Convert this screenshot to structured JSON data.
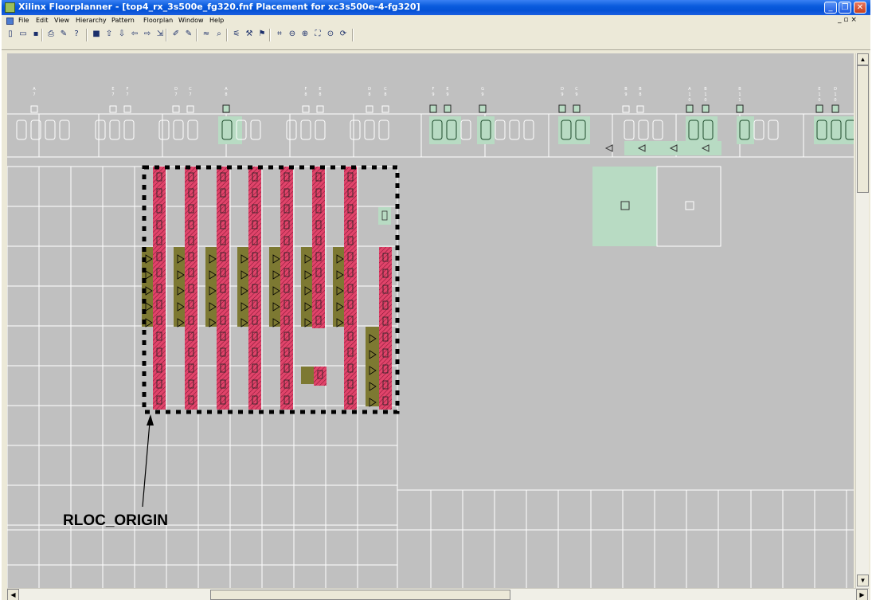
{
  "window": {
    "title": "Xilinx Floorplanner - [top4_rx_3s500e_fg320.fnf Placement for xc3s500e-4-fg320]",
    "minimize_icon": "minimize-icon",
    "maximize_icon": "restore-icon",
    "close_icon": "close-icon"
  },
  "menu": {
    "items": [
      "File",
      "Edit",
      "View",
      "Hierarchy",
      "Pattern",
      "Floorplan",
      "Window",
      "Help"
    ],
    "mdi_controls": "_ ▫ ×"
  },
  "toolbar": {
    "icons": [
      "new-icon",
      "open-icon",
      "save-icon",
      "print-icon",
      "tools-icon",
      "help-cursor-icon",
      "block-icon",
      "hierarchy-up-icon",
      "hierarchy-down-icon",
      "hierarchy-left-icon",
      "hierarchy-right-icon",
      "hierarchy-expand-icon",
      "pin-icon",
      "pin-alt-icon",
      "filter-icon",
      "find-icon",
      "route-icon",
      "edit-icon",
      "flag-icon",
      "zoom-fit-icon",
      "zoom-out-icon",
      "zoom-in-icon",
      "zoom-full-icon",
      "zoom-select-icon",
      "refresh-icon"
    ]
  },
  "pins": {
    "labels": [
      [
        "A",
        "7"
      ],
      [
        "E",
        "7"
      ],
      [
        "F",
        "7"
      ],
      [
        "D",
        "7"
      ],
      [
        "C",
        "7"
      ],
      [
        "A",
        "8"
      ],
      [
        "F",
        "8"
      ],
      [
        "E",
        "8"
      ],
      [
        "D",
        "8"
      ],
      [
        "C",
        "8"
      ],
      [
        "F",
        "9"
      ],
      [
        "E",
        "9"
      ],
      [
        "G",
        "9"
      ],
      [
        "D",
        "9"
      ],
      [
        "C",
        "9"
      ],
      [
        "B",
        "9"
      ],
      [
        "B",
        "8"
      ],
      [
        "A",
        "10"
      ],
      [
        "B",
        "10"
      ],
      [
        "B",
        "11"
      ],
      [
        "E",
        "10"
      ],
      [
        "D",
        "10"
      ]
    ]
  },
  "colors": {
    "canvas": "#c0c0c0",
    "grid_line": "#ffffff",
    "placed_green": "#b8dbc3",
    "olive_block": "#7d7932",
    "carry_chain": "#e0446a",
    "rpm_border": "#000000"
  },
  "annotation": {
    "label": "RLOC_ORIGIN"
  }
}
